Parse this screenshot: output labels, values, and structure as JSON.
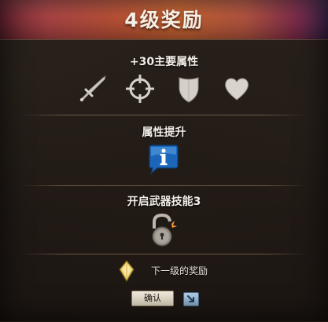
{
  "window": {
    "title": "4级奖励"
  },
  "stats_section": {
    "title": "+30主要属性",
    "icons": [
      "sword-icon",
      "crosshair-icon",
      "shield-icon",
      "heart-icon"
    ]
  },
  "attribute_section": {
    "title": "属性提升",
    "icon": "info-icon"
  },
  "skill_section": {
    "title": "开启武器技能3",
    "icon": "unlock-icon"
  },
  "next_reward": {
    "label": "下一级的奖励",
    "icon": "gem-icon"
  },
  "confirm_button": {
    "label": "确认"
  },
  "colors": {
    "title_bar_red": "#c9583b",
    "title_bar_purple": "#4a2c5a",
    "panel_bg": "#1d1612",
    "text": "#f3eee6",
    "info_blue": "#1b66b8",
    "gem_gold": "#e7c85a"
  }
}
